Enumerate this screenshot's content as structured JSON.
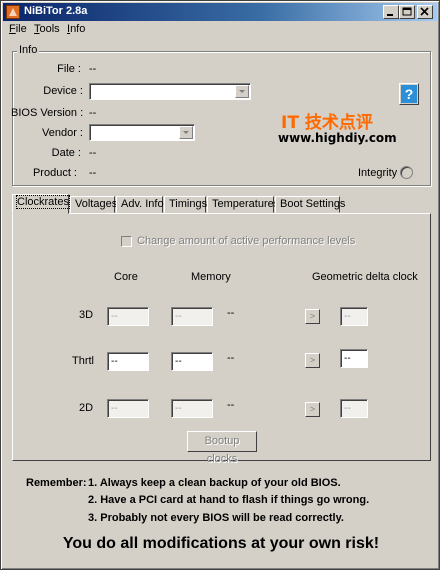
{
  "window": {
    "title": "NiBiTor 2.8a",
    "colors": {
      "face": "#d4d0c8",
      "title_start": "#0a246a",
      "title_end": "#a6caf0",
      "watermark": "#ff6a00"
    }
  },
  "menu": [
    {
      "hotkey": "F",
      "rest": "ile"
    },
    {
      "hotkey": "T",
      "rest": "ools"
    },
    {
      "hotkey": "I",
      "rest": "nfo"
    }
  ],
  "info": {
    "group_label": "Info",
    "file_label": "File :",
    "file_value": "--",
    "device_label": "Device :",
    "bios_label": "BIOS Version :",
    "bios_value": "--",
    "vendor_label": "Vendor :",
    "date_label": "Date :",
    "date_value": "--",
    "product_label": "Product :",
    "product_value": "--",
    "integrity_label": "Integrity :",
    "help_label": "?"
  },
  "watermark": {
    "line1": "IT 技术点评",
    "line2": "www.highdiy.com"
  },
  "tabs": [
    "Clockrates",
    "Voltages",
    "Adv. Info",
    "Timings",
    "Temperatures",
    "Boot Settings"
  ],
  "clockrates": {
    "checkbox_label": "Change amount of active performance levels",
    "headers": {
      "core": "Core",
      "memory": "Memory",
      "delta": "Geometric delta clock"
    },
    "rows": [
      {
        "label": "3D",
        "core": "--",
        "memory": "--",
        "sep": "--",
        "delta": "--"
      },
      {
        "label": "Thrtl",
        "core": "--",
        "memory": "--",
        "sep": "--",
        "delta": "--"
      },
      {
        "label": "2D",
        "core": "--",
        "memory": "--",
        "sep": "--",
        "delta": "--"
      }
    ],
    "arrow_label": ">",
    "bootup_button": "Bootup clocks"
  },
  "footer": {
    "remember_label": "Remember:",
    "lines": [
      "1. Always keep a clean backup of your old BIOS.",
      "2. Have a PCI card at hand to flash if things go wrong.",
      "3. Probably not every BIOS will be read correctly."
    ],
    "warning": "You do all modifications at your own risk!"
  }
}
